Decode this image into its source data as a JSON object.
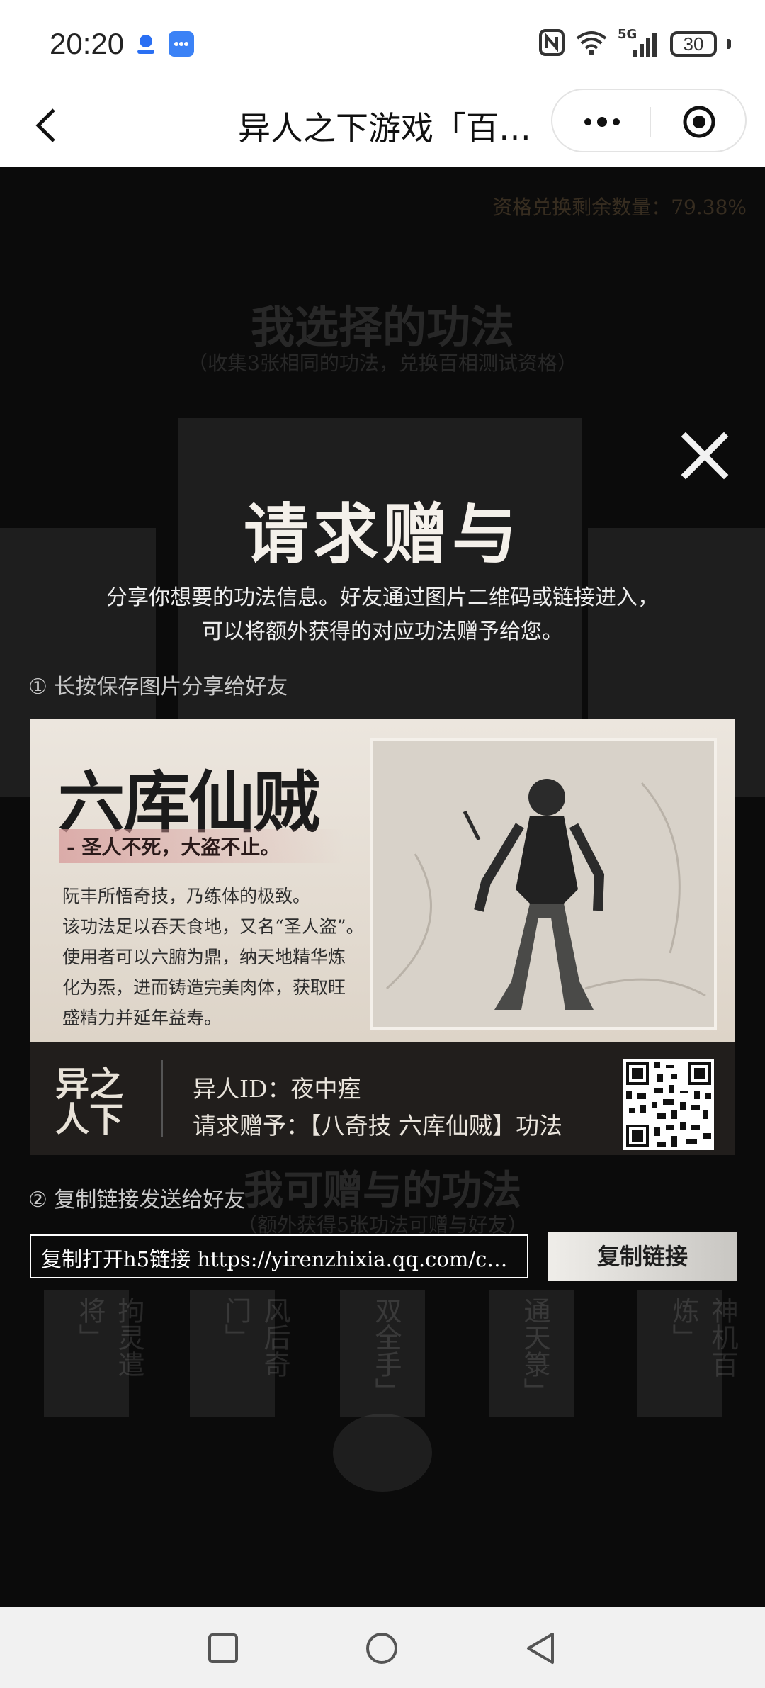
{
  "status_bar": {
    "time": "20:20",
    "network": "5G",
    "battery": "30"
  },
  "nav": {
    "title": "异人之下游戏「百…"
  },
  "background": {
    "remaining": "资格兑换剩余数量：79.38%",
    "section1_title": "我选择的功法",
    "section1_sub": "（收集3张相同的功法，兑换百相测试资格）",
    "section2_title": "我可赠与的功法",
    "section2_sub": "（额外获得5张功法可赠与好友）",
    "skills": [
      "拘灵遣将」",
      "风后奇门」",
      "双全手」",
      "通天箓」",
      "神机百炼」"
    ]
  },
  "modal": {
    "title": "请求赠与",
    "desc_line1": "分享你想要的功法信息。好友通过图片二维码或链接进入，",
    "desc_line2": "可以将额外获得的对应功法赠予给您。",
    "step1": "① 长按保存图片分享给好友",
    "step2": "② 复制链接发送给好友",
    "link_text": "复制打开h5链接 https://yirenzhixia.qq.com/cp/…",
    "copy_button": "复制链接"
  },
  "poster": {
    "title": "六库仙贼",
    "tagline": "- 圣人不死，大盗不止。",
    "body": [
      "阮丰所悟奇技，乃练体的极致。",
      "该功法足以吞天食地，又名“圣人盗”。",
      "使用者可以六腑为鼎，纳天地精华炼",
      "化为炁，进而铸造完美肉体，获取旺",
      "盛精力并延年益寿。"
    ],
    "logo": "异人之下",
    "user_id": "异人ID：夜中痓",
    "request": "请求赠予：【八奇技 六库仙贼】功法"
  }
}
